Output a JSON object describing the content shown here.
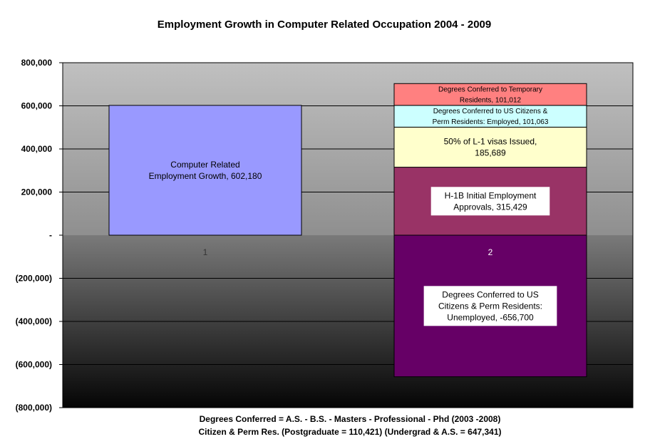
{
  "chart_data": {
    "type": "bar",
    "stacked": true,
    "title": "Employment Growth in Computer Related Occupation 2004 - 2009",
    "xlabel_lines": [
      "Degrees Conferred = A.S. -  B.S. - Masters - Professional - Phd (2003 -2008)",
      "Citizen & Perm Res. (Postgraduate = 110,421)     (Undergrad & A.S. = 647,341)"
    ],
    "ylabel": "",
    "ylim": [
      -800000,
      800000
    ],
    "yticks": [
      800000,
      600000,
      400000,
      200000,
      0,
      -200000,
      -400000,
      -600000,
      -800000
    ],
    "ytick_labels": [
      "800,000",
      "600,000",
      "400,000",
      "200,000",
      "-",
      "(200,000)",
      "(400,000)",
      "(600,000)",
      "(800,000)"
    ],
    "categories": [
      "1",
      "2"
    ],
    "grid": true,
    "segments": [
      {
        "category": "1",
        "value": 602180,
        "label": [
          "Computer Related",
          "Employment Growth,  602,180"
        ],
        "color": "#9999ff",
        "label_box": false
      },
      {
        "category": "2",
        "value": 315429,
        "label": [
          "H-1B Initial Employment",
          "Approvals, 315,429"
        ],
        "color": "#993366",
        "label_box": true
      },
      {
        "category": "2",
        "value": 185689,
        "label": [
          "50% of L-1 visas Issued,",
          "185,689"
        ],
        "color": "#ffffcc",
        "label_box": false
      },
      {
        "category": "2",
        "value": 101063,
        "label": [
          "Degrees Conferred to US Citizens &",
          "Perm Residents: Employed, 101,063"
        ],
        "color": "#ccffff",
        "label_box": false
      },
      {
        "category": "2",
        "value": 101012,
        "label": [
          "Degrees Conferred to Temporary",
          "Residents, 101,012"
        ],
        "color": "#ff8080",
        "label_box": false
      },
      {
        "category": "2",
        "value": -656700,
        "label": [
          "Degrees Conferred to US",
          "Citizens & Perm Residents:",
          "Unemployed, -656,700"
        ],
        "color": "#660066",
        "label_box": true
      }
    ]
  }
}
